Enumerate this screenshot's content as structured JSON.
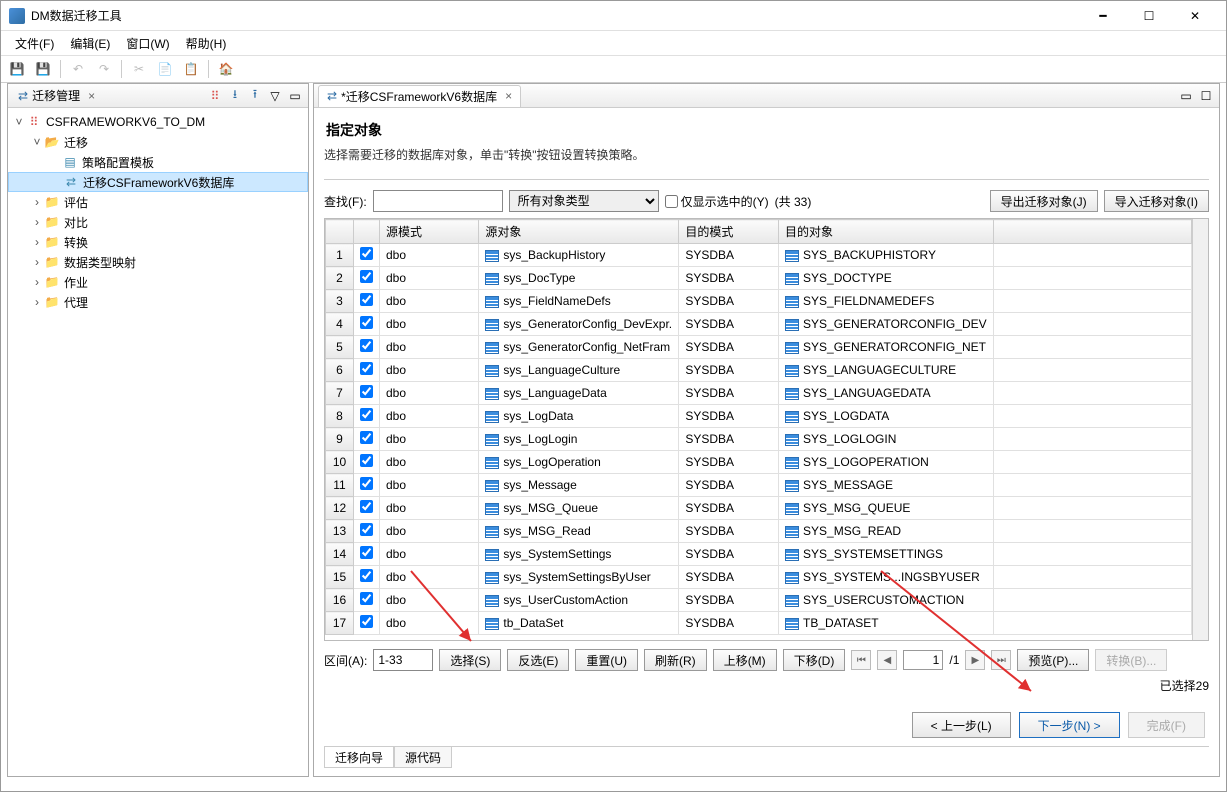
{
  "window": {
    "title": "DM数据迁移工具"
  },
  "menu": {
    "file": "文件(F)",
    "edit": "编辑(E)",
    "window": "窗口(W)",
    "help": "帮助(H)"
  },
  "leftPanel": {
    "tabLabel": "迁移管理",
    "root": "CSFRAMEWORKV6_TO_DM",
    "nodes": {
      "migration": "迁移",
      "policyTemplate": "策略配置模板",
      "migrateDb": "迁移CSFrameworkV6数据库",
      "evaluate": "评估",
      "compare": "对比",
      "convert": "转换",
      "typeMapping": "数据类型映射",
      "job": "作业",
      "agent": "代理"
    }
  },
  "editor": {
    "tabLabel": "*迁移CSFrameworkV6数据库",
    "sectionTitle": "指定对象",
    "sectionDesc": "选择需要迁移的数据库对象，单击\"转换\"按钮设置转换策略。",
    "searchLabel": "查找(F):",
    "objectTypeLabel": "所有对象类型",
    "showSelectedOnly": "仅显示选中的(Y)",
    "totalLabel": "(共 33)",
    "exportBtn": "导出迁移对象(J)",
    "importBtn": "导入迁移对象(I)",
    "columns": {
      "srcSchema": "源模式",
      "srcObject": "源对象",
      "tgtSchema": "目的模式",
      "tgtObject": "目的对象"
    },
    "rows": [
      {
        "n": "1",
        "srcSchema": "dbo",
        "srcObject": "sys_BackupHistory",
        "tgtSchema": "SYSDBA",
        "tgtObject": "SYS_BACKUPHISTORY"
      },
      {
        "n": "2",
        "srcSchema": "dbo",
        "srcObject": "sys_DocType",
        "tgtSchema": "SYSDBA",
        "tgtObject": "SYS_DOCTYPE"
      },
      {
        "n": "3",
        "srcSchema": "dbo",
        "srcObject": "sys_FieldNameDefs",
        "tgtSchema": "SYSDBA",
        "tgtObject": "SYS_FIELDNAMEDEFS"
      },
      {
        "n": "4",
        "srcSchema": "dbo",
        "srcObject": "sys_GeneratorConfig_DevExpr.",
        "tgtSchema": "SYSDBA",
        "tgtObject": "SYS_GENERATORCONFIG_DEV"
      },
      {
        "n": "5",
        "srcSchema": "dbo",
        "srcObject": "sys_GeneratorConfig_NetFram",
        "tgtSchema": "SYSDBA",
        "tgtObject": "SYS_GENERATORCONFIG_NET"
      },
      {
        "n": "6",
        "srcSchema": "dbo",
        "srcObject": "sys_LanguageCulture",
        "tgtSchema": "SYSDBA",
        "tgtObject": "SYS_LANGUAGECULTURE"
      },
      {
        "n": "7",
        "srcSchema": "dbo",
        "srcObject": "sys_LanguageData",
        "tgtSchema": "SYSDBA",
        "tgtObject": "SYS_LANGUAGEDATA"
      },
      {
        "n": "8",
        "srcSchema": "dbo",
        "srcObject": "sys_LogData",
        "tgtSchema": "SYSDBA",
        "tgtObject": "SYS_LOGDATA"
      },
      {
        "n": "9",
        "srcSchema": "dbo",
        "srcObject": "sys_LogLogin",
        "tgtSchema": "SYSDBA",
        "tgtObject": "SYS_LOGLOGIN"
      },
      {
        "n": "10",
        "srcSchema": "dbo",
        "srcObject": "sys_LogOperation",
        "tgtSchema": "SYSDBA",
        "tgtObject": "SYS_LOGOPERATION"
      },
      {
        "n": "11",
        "srcSchema": "dbo",
        "srcObject": "sys_Message",
        "tgtSchema": "SYSDBA",
        "tgtObject": "SYS_MESSAGE"
      },
      {
        "n": "12",
        "srcSchema": "dbo",
        "srcObject": "sys_MSG_Queue",
        "tgtSchema": "SYSDBA",
        "tgtObject": "SYS_MSG_QUEUE"
      },
      {
        "n": "13",
        "srcSchema": "dbo",
        "srcObject": "sys_MSG_Read",
        "tgtSchema": "SYSDBA",
        "tgtObject": "SYS_MSG_READ"
      },
      {
        "n": "14",
        "srcSchema": "dbo",
        "srcObject": "sys_SystemSettings",
        "tgtSchema": "SYSDBA",
        "tgtObject": "SYS_SYSTEMSETTINGS"
      },
      {
        "n": "15",
        "srcSchema": "dbo",
        "srcObject": "sys_SystemSettingsByUser",
        "tgtSchema": "SYSDBA",
        "tgtObject": "SYS_SYSTEMS...INGSBYUSER"
      },
      {
        "n": "16",
        "srcSchema": "dbo",
        "srcObject": "sys_UserCustomAction",
        "tgtSchema": "SYSDBA",
        "tgtObject": "SYS_USERCUSTOMACTION"
      },
      {
        "n": "17",
        "srcSchema": "dbo",
        "srcObject": "tb_DataSet",
        "tgtSchema": "SYSDBA",
        "tgtObject": "TB_DATASET"
      }
    ],
    "rangeLabel": "区间(A):",
    "rangeValue": "1-33",
    "selectBtn": "选择(S)",
    "invertBtn": "反选(E)",
    "resetBtn": "重置(U)",
    "refreshBtn": "刷新(R)",
    "moveUpBtn": "上移(M)",
    "moveDownBtn": "下移(D)",
    "pageValue": "1",
    "pageTotal": "/1",
    "previewBtn": "预览(P)...",
    "convertBtn": "转换(B)...",
    "selectedCount": "已选择29",
    "prevStep": "< 上一步(L)",
    "nextStep": "下一步(N) >",
    "finish": "完成(F)",
    "bottomTabs": {
      "wizard": "迁移向导",
      "source": "源代码"
    }
  }
}
